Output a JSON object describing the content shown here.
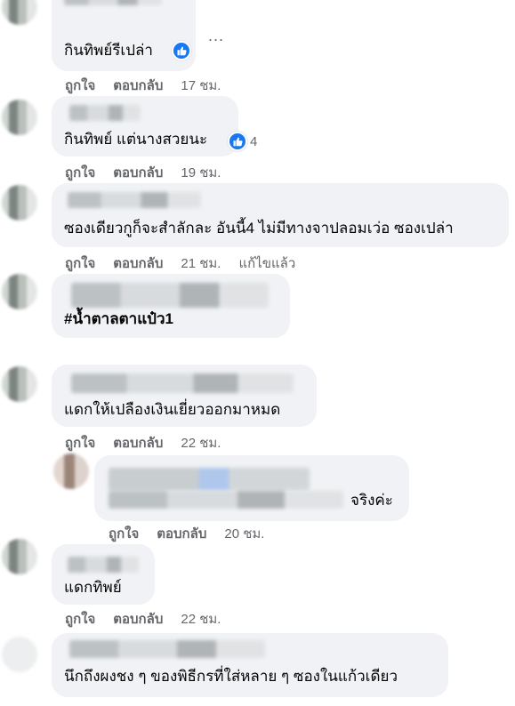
{
  "comments": [
    {
      "text": "กินทิพย์รีเปล่า",
      "like": "ถูกใจ",
      "reply": "ตอบกลับ",
      "time": "17 ชม.",
      "more": "..."
    },
    {
      "text": "กินทิพย์ แต่นางสวยนะ",
      "like": "ถูกใจ",
      "reply": "ตอบกลับ",
      "time": "19 ชม.",
      "reaction_count": "4"
    },
    {
      "text": "ซองเดียวกูก็จะสำลักละ อันนี้4 ไม่มีทางจาปลอมเว่อ ซองเปล่า",
      "like": "ถูกใจ",
      "reply": "ตอบกลับ",
      "time": "21 ชม.",
      "edited": "แก้ไขแล้ว"
    },
    {
      "text": "#น้ำตาลตาแป๋ว1"
    },
    {
      "text": "แดกให้เปลืองเงินเยี่ยวออกมาหมด",
      "like": "ถูกใจ",
      "reply": "ตอบกลับ",
      "time": "22 ชม."
    },
    {
      "text": "จริงค่ะ",
      "like": "ถูกใจ",
      "reply": "ตอบกลับ",
      "time": "20 ชม."
    },
    {
      "text": "แดกทิพย์",
      "like": "ถูกใจ",
      "reply": "ตอบกลับ",
      "time": "22 ชม."
    },
    {
      "text": "นึกถึงผงชง ๆ ของพิธีกรที่ใส่หลาย ๆ ซองในแก้วเดียว"
    }
  ],
  "colors": {
    "like_blue": "#1877f2",
    "bubble": "#f0f2f5",
    "meta": "#65676b"
  },
  "icons": {
    "like": "thumbs-up-icon",
    "more": "more-dots-icon"
  }
}
